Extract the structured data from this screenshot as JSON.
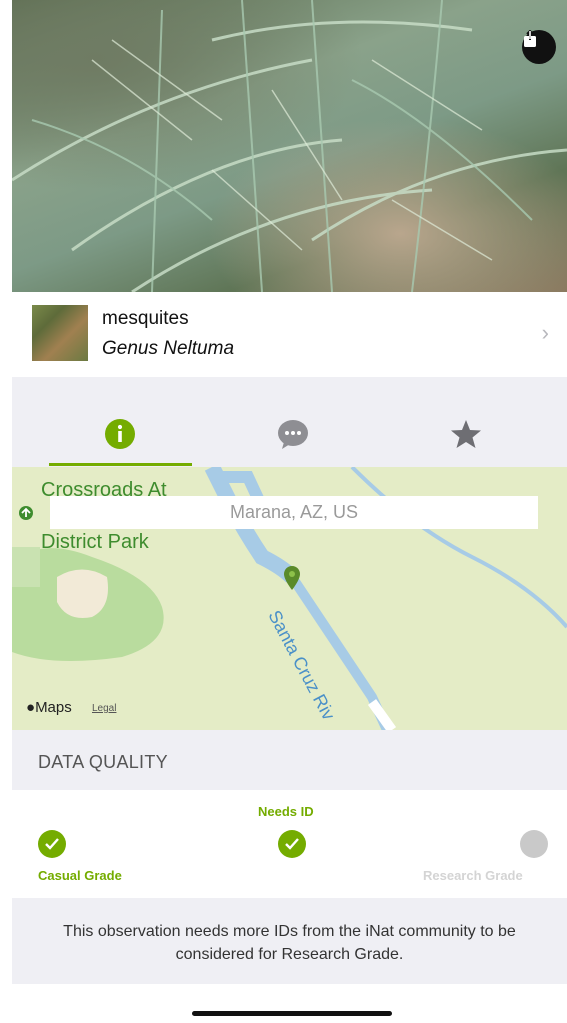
{
  "taxon": {
    "common_name": "mesquites",
    "scientific_name": "Genus Neltuma"
  },
  "map": {
    "park_label_line1": "Crossroads At",
    "park_label_line2": "District Park",
    "place": "Marana, AZ, US",
    "river": "Santa Cruz Riv",
    "maps_logo": "Maps",
    "legal": "Legal"
  },
  "data_quality": {
    "title": "DATA QUALITY",
    "grades": [
      {
        "label": "Casual Grade",
        "achieved": true
      },
      {
        "label": "Needs ID",
        "achieved": true
      },
      {
        "label": "Research Grade",
        "achieved": false
      }
    ],
    "message": "This observation needs more IDs from the iNat community to be considered for Research Grade."
  },
  "icons": [
    "share-icon",
    "info-icon",
    "comments-icon",
    "star-icon",
    "chevron-right-icon",
    "check-icon"
  ],
  "colors": {
    "accent": "#74ac00",
    "grade_inactive": "#c9c9c9",
    "background_gray": "#efeff4"
  }
}
